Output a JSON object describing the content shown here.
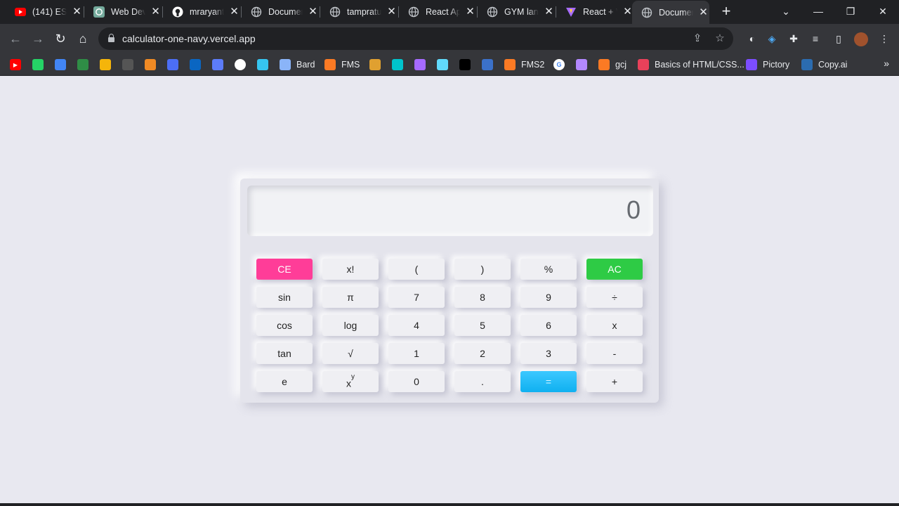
{
  "browser": {
    "tabs": [
      {
        "label": "(141) ES6",
        "icon": "youtube-icon",
        "color": "#ff0000"
      },
      {
        "label": "Web Dev",
        "icon": "chatgpt-icon",
        "color": "#74aa9c"
      },
      {
        "label": "mraryant",
        "icon": "github-icon",
        "color": "#ffffff"
      },
      {
        "label": "Documen",
        "icon": "globe-icon",
        "color": "#bdc1c6"
      },
      {
        "label": "tampratu",
        "icon": "globe-icon",
        "color": "#bdc1c6"
      },
      {
        "label": "React Ap",
        "icon": "globe-icon",
        "color": "#bdc1c6"
      },
      {
        "label": "GYM lan",
        "icon": "globe-icon",
        "color": "#bdc1c6"
      },
      {
        "label": "React + V",
        "icon": "vite-icon",
        "color": "#a66bff"
      },
      {
        "label": "Documen",
        "icon": "globe-icon",
        "color": "#bdc1c6",
        "active": true
      }
    ],
    "url": "calculator-one-navy.vercel.app",
    "bookmarks": [
      {
        "label": "",
        "icon": "youtube-icon",
        "color": "#ff0000"
      },
      {
        "label": "",
        "icon": "whatsapp-icon",
        "color": "#25d366"
      },
      {
        "label": "",
        "icon": "translate-icon",
        "color": "#4285f4"
      },
      {
        "label": "",
        "icon": "geeksforgeeks-icon",
        "color": "#2f8d46"
      },
      {
        "label": "",
        "icon": "codepen-icon",
        "color": "#f5b50a"
      },
      {
        "label": "",
        "icon": "cc-icon",
        "color": "#555555"
      },
      {
        "label": "",
        "icon": "codeforces-icon",
        "color": "#f08a24"
      },
      {
        "label": "",
        "icon": "app-icon",
        "color": "#4c6ef5"
      },
      {
        "label": "",
        "icon": "linkedin-icon",
        "color": "#0a66c2"
      },
      {
        "label": "",
        "icon": "app2-icon",
        "color": "#5c7cfa"
      },
      {
        "label": "",
        "icon": "github-icon",
        "color": "#ffffff"
      },
      {
        "label": "",
        "icon": "slack-icon",
        "color": "#36c5f0"
      },
      {
        "label": "Bard",
        "icon": "bard-icon",
        "color": "#8ab4f8"
      },
      {
        "label": "FMS",
        "icon": "xampp-icon",
        "color": "#fb7a24"
      },
      {
        "label": "",
        "icon": "mdn-icon",
        "color": "#e0a030"
      },
      {
        "label": "",
        "icon": "canva-icon",
        "color": "#00c4cc"
      },
      {
        "label": "",
        "icon": "vite-icon",
        "color": "#a66bff"
      },
      {
        "label": "",
        "icon": "react-icon",
        "color": "#61dafb"
      },
      {
        "label": "",
        "icon": "black-square-icon",
        "color": "#000000"
      },
      {
        "label": "",
        "icon": "mdb-icon",
        "color": "#3b71ca"
      },
      {
        "label": "FMS2",
        "icon": "xampp-icon",
        "color": "#fb7a24"
      },
      {
        "label": "",
        "icon": "google-icon",
        "color": "#ffffff"
      },
      {
        "label": "",
        "icon": "avatar-icon",
        "color": "#b388ff"
      },
      {
        "label": "gcj",
        "icon": "xampp-icon",
        "color": "#fb7a24"
      },
      {
        "label": "Basics of HTML/CSS...",
        "icon": "bookmark-red-icon",
        "color": "#e8415a"
      },
      {
        "label": "Pictory",
        "icon": "pictory-icon",
        "color": "#7c4dff"
      },
      {
        "label": "Copy.ai",
        "icon": "copyai-icon",
        "color": "#2b6cb0"
      }
    ]
  },
  "calculator": {
    "display": "0",
    "rows": [
      [
        {
          "label": "CE",
          "kind": "ce"
        },
        {
          "label": "x!"
        },
        {
          "label": "("
        },
        {
          "label": ")"
        },
        {
          "label": "%"
        },
        {
          "label": "AC",
          "kind": "ac"
        }
      ],
      [
        {
          "label": "sin"
        },
        {
          "label": "π"
        },
        {
          "label": "7"
        },
        {
          "label": "8"
        },
        {
          "label": "9"
        },
        {
          "label": "÷"
        }
      ],
      [
        {
          "label": "cos"
        },
        {
          "label": "log"
        },
        {
          "label": "4"
        },
        {
          "label": "5"
        },
        {
          "label": "6"
        },
        {
          "label": "x"
        }
      ],
      [
        {
          "label": "tan"
        },
        {
          "label": "√"
        },
        {
          "label": "1"
        },
        {
          "label": "2"
        },
        {
          "label": "3"
        },
        {
          "label": "-"
        }
      ],
      [
        {
          "label": "e"
        },
        {
          "label": "x",
          "sup": "y"
        },
        {
          "label": "0"
        },
        {
          "label": "."
        },
        {
          "label": "=",
          "kind": "eq"
        },
        {
          "label": "+"
        }
      ]
    ],
    "colors": {
      "ce": "#ff3d98",
      "ac": "#2ecb45",
      "equals": "#1dbbf7",
      "background": "#e8e8f0"
    }
  }
}
